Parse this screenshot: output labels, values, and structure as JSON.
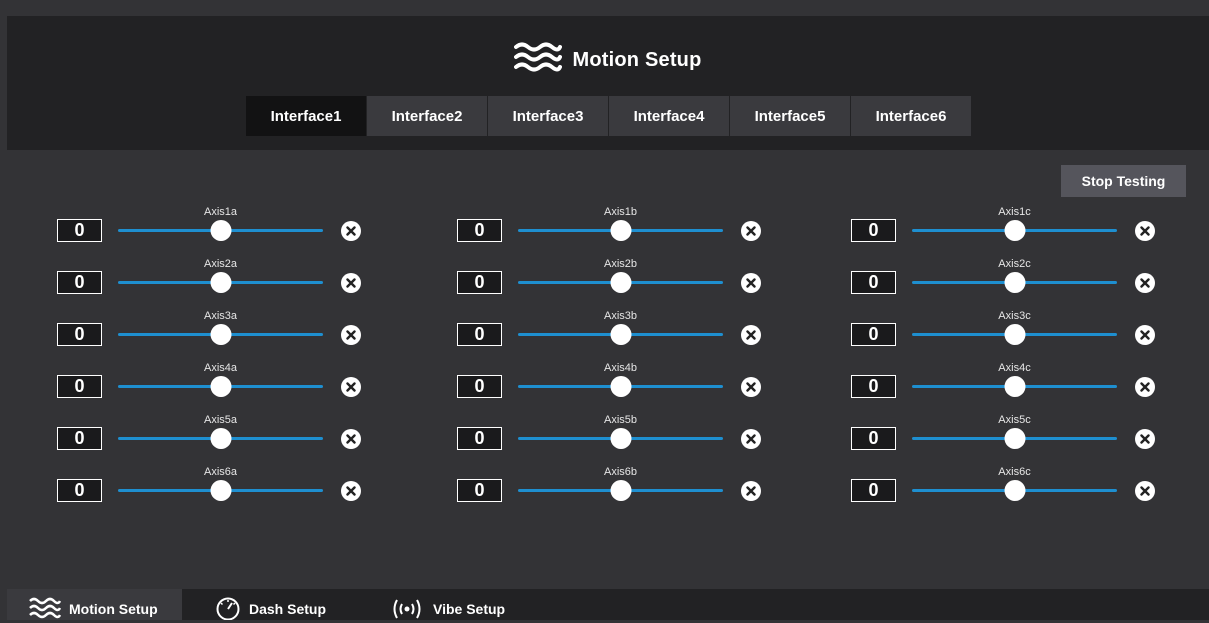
{
  "header": {
    "title": "Motion Setup",
    "icon": "waves-icon",
    "tabs": [
      {
        "label": "Interface1",
        "active": true
      },
      {
        "label": "Interface2",
        "active": false
      },
      {
        "label": "Interface3",
        "active": false
      },
      {
        "label": "Interface4",
        "active": false
      },
      {
        "label": "Interface5",
        "active": false
      },
      {
        "label": "Interface6",
        "active": false
      }
    ]
  },
  "controls": {
    "stop_label": "Stop Testing"
  },
  "axes": {
    "columns": [
      [
        {
          "label": "Axis1a",
          "value": "0",
          "slider": 0.5
        },
        {
          "label": "Axis2a",
          "value": "0",
          "slider": 0.5
        },
        {
          "label": "Axis3a",
          "value": "0",
          "slider": 0.5
        },
        {
          "label": "Axis4a",
          "value": "0",
          "slider": 0.5
        },
        {
          "label": "Axis5a",
          "value": "0",
          "slider": 0.5
        },
        {
          "label": "Axis6a",
          "value": "0",
          "slider": 0.5
        }
      ],
      [
        {
          "label": "Axis1b",
          "value": "0",
          "slider": 0.5
        },
        {
          "label": "Axis2b",
          "value": "0",
          "slider": 0.5
        },
        {
          "label": "Axis3b",
          "value": "0",
          "slider": 0.5
        },
        {
          "label": "Axis4b",
          "value": "0",
          "slider": 0.5
        },
        {
          "label": "Axis5b",
          "value": "0",
          "slider": 0.5
        },
        {
          "label": "Axis6b",
          "value": "0",
          "slider": 0.5
        }
      ],
      [
        {
          "label": "Axis1c",
          "value": "0",
          "slider": 0.5
        },
        {
          "label": "Axis2c",
          "value": "0",
          "slider": 0.5
        },
        {
          "label": "Axis3c",
          "value": "0",
          "slider": 0.5
        },
        {
          "label": "Axis4c",
          "value": "0",
          "slider": 0.5
        },
        {
          "label": "Axis5c",
          "value": "0",
          "slider": 0.5
        },
        {
          "label": "Axis6c",
          "value": "0",
          "slider": 0.5
        }
      ]
    ]
  },
  "footer": {
    "tabs": [
      {
        "label": "Motion Setup",
        "icon": "waves-icon",
        "active": true
      },
      {
        "label": "Dash Setup",
        "icon": "gauge-icon",
        "active": false
      },
      {
        "label": "Vibe Setup",
        "icon": "vibration-icon",
        "active": false
      }
    ]
  },
  "colors": {
    "background": "#333336",
    "panel": "#222224",
    "accent": "#1e8fd0",
    "active_tab": "#121213"
  }
}
